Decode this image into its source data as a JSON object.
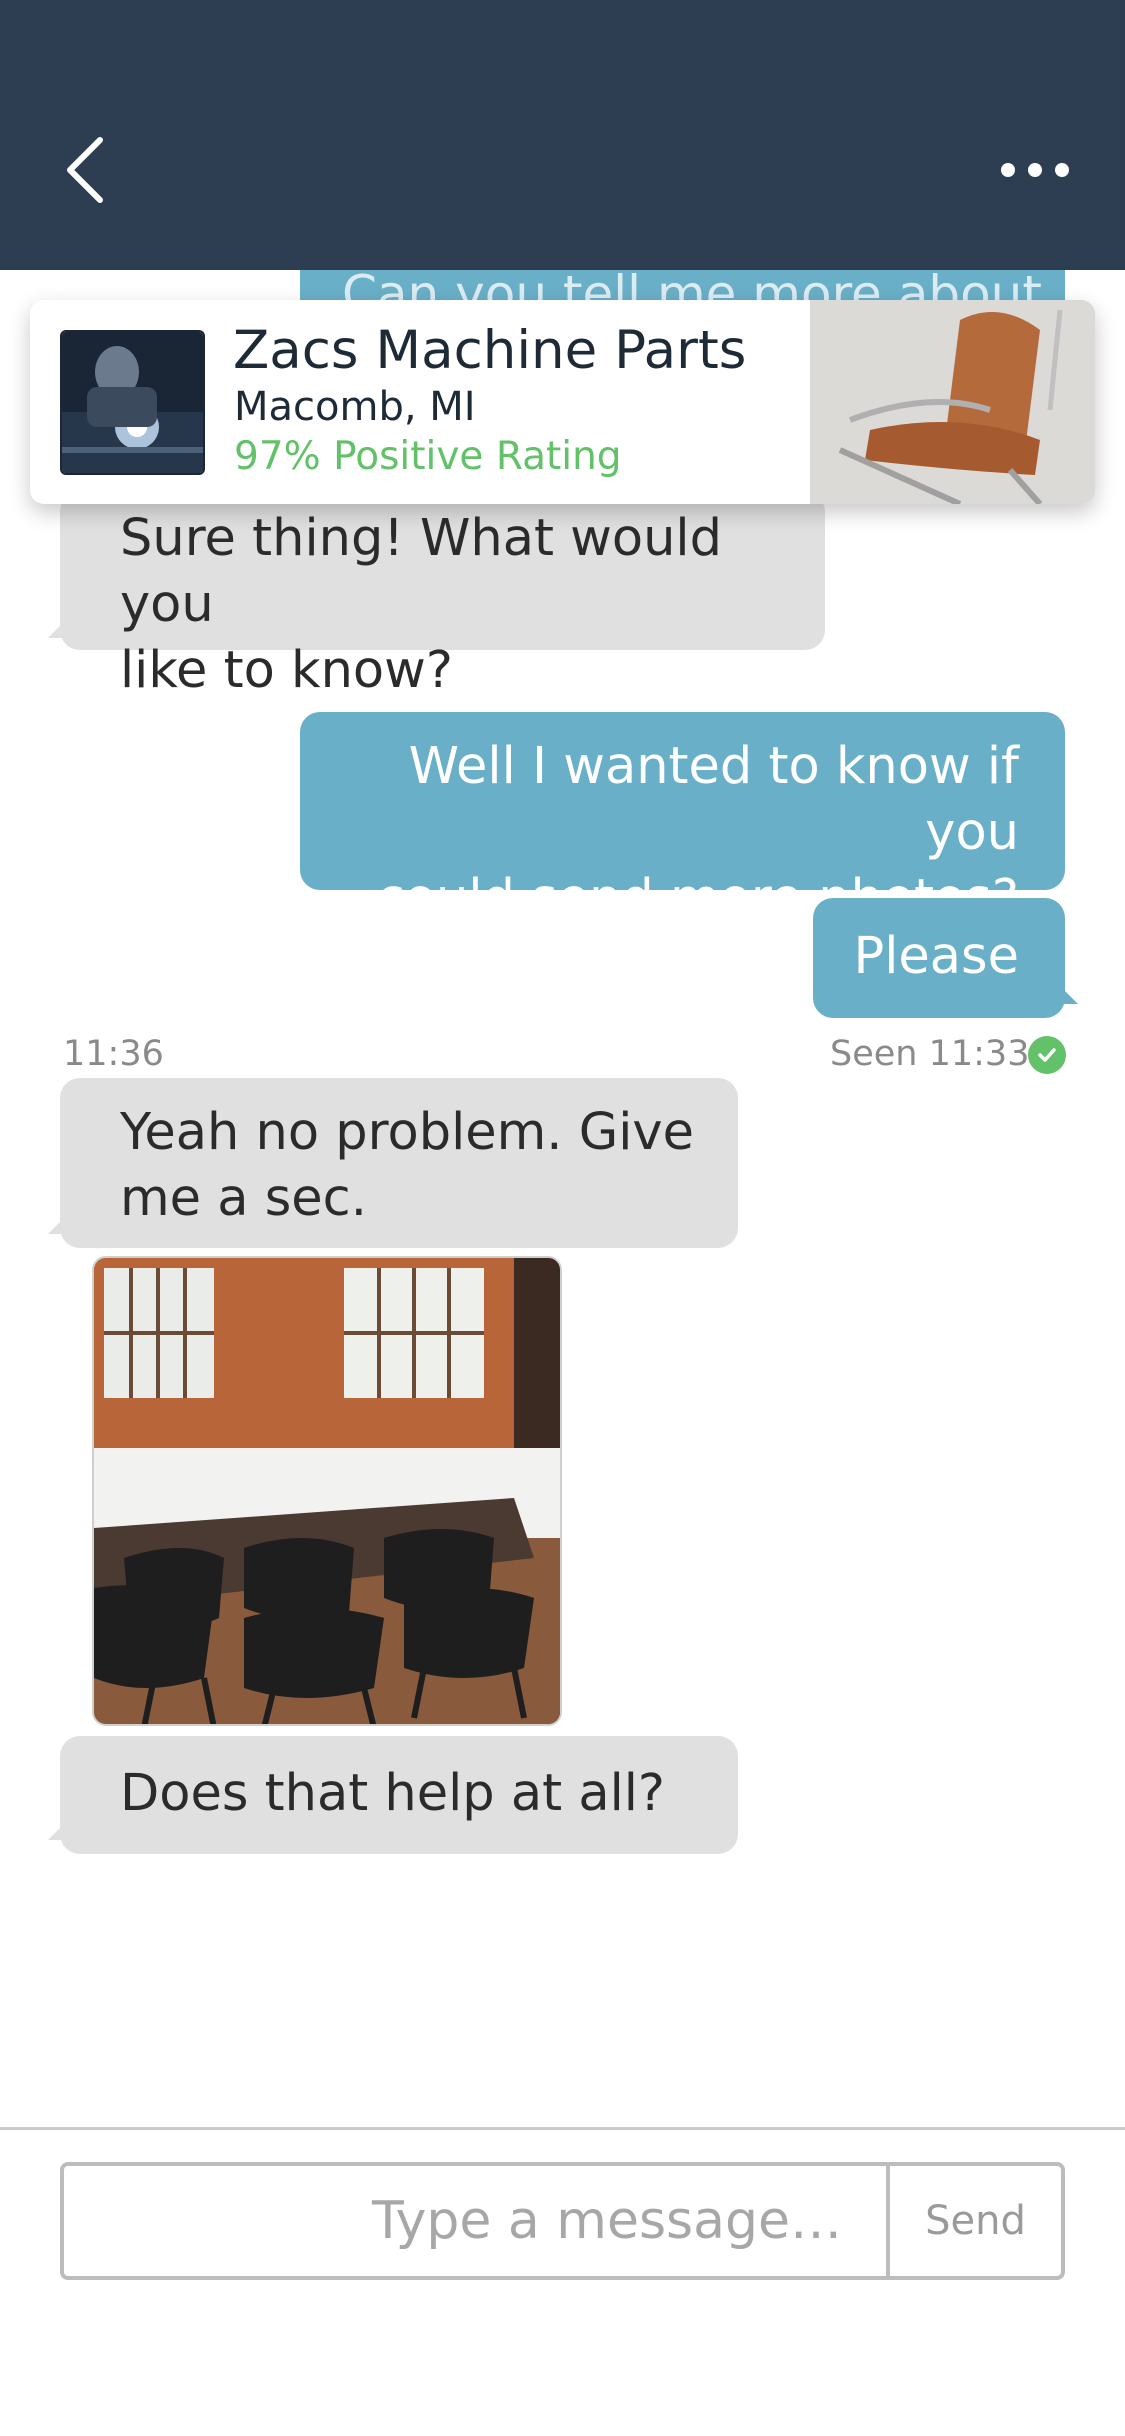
{
  "header": {
    "back_icon": "chevron-left-icon",
    "more_icon": "more-horizontal-icon",
    "background": "#2e3e52"
  },
  "peek_message": {
    "text": "Can you tell me more about"
  },
  "seller": {
    "name": "Zacs Machine Parts",
    "location": "Macomb, MI",
    "rating": "97% Positive Rating",
    "rating_color": "#63c16a"
  },
  "messages": [
    {
      "direction": "incoming",
      "text_lines": [
        "Sure thing! What would you",
        "like to know?"
      ]
    },
    {
      "direction": "outgoing",
      "text_lines": [
        "Well I wanted to know if you",
        "could send more photos?"
      ]
    },
    {
      "direction": "outgoing",
      "text_lines": [
        "Please"
      ]
    },
    {
      "direction": "incoming",
      "text_lines": [
        "Yeah no problem. Give",
        "me a sec."
      ]
    },
    {
      "direction": "incoming",
      "type": "image",
      "alt": "conference room photo"
    },
    {
      "direction": "incoming",
      "text_lines": [
        "Does that help at all?"
      ]
    }
  ],
  "timestamps": {
    "incoming_time": "11:36",
    "seen_text": "Seen 11:33",
    "seen_icon": "check-circle-icon"
  },
  "composer": {
    "placeholder": "Type a message…",
    "value": "",
    "send_label": "Send"
  },
  "colors": {
    "outgoing_bubble": "#6aafc8",
    "incoming_bubble": "#e0e0e0",
    "accent_green": "#63c16a"
  }
}
